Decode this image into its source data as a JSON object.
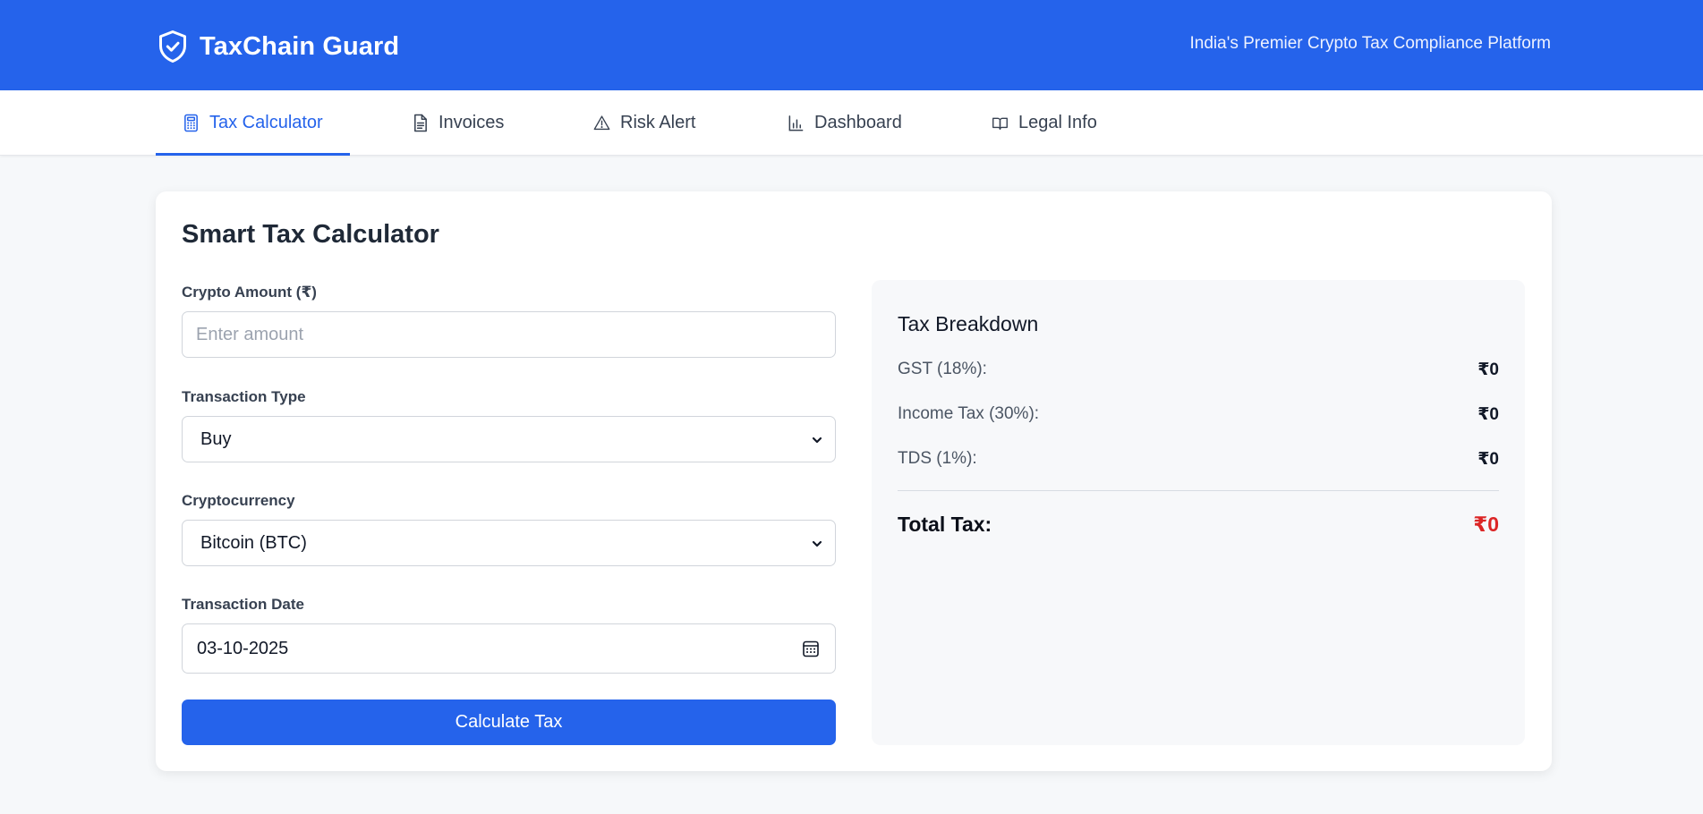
{
  "header": {
    "brand": "TaxChain Guard",
    "tagline": "India's Premier Crypto Tax Compliance Platform",
    "logo_icon": "shield-check-icon",
    "background_color": "#2563eb"
  },
  "nav": {
    "active_color": "#2563eb",
    "tabs": [
      {
        "label": "Tax Calculator",
        "icon": "calculator-icon",
        "active": true
      },
      {
        "label": "Invoices",
        "icon": "document-icon",
        "active": false
      },
      {
        "label": "Risk Alert",
        "icon": "warning-icon",
        "active": false
      },
      {
        "label": "Dashboard",
        "icon": "bar-chart-icon",
        "active": false
      },
      {
        "label": "Legal Info",
        "icon": "book-icon",
        "active": false
      }
    ]
  },
  "calculator": {
    "title": "Smart Tax Calculator",
    "amount": {
      "label": "Crypto Amount (₹)",
      "placeholder": "Enter amount",
      "value": ""
    },
    "transaction_type": {
      "label": "Transaction Type",
      "selected": "Buy"
    },
    "cryptocurrency": {
      "label": "Cryptocurrency",
      "selected": "Bitcoin (BTC)"
    },
    "date": {
      "label": "Transaction Date",
      "value": "03-10-2025"
    },
    "submit_label": "Calculate Tax"
  },
  "breakdown": {
    "title": "Tax Breakdown",
    "rows": [
      {
        "label": "GST (18%):",
        "value": "₹0"
      },
      {
        "label": "Income Tax (30%):",
        "value": "₹0"
      },
      {
        "label": "TDS (1%):",
        "value": "₹0"
      }
    ],
    "total": {
      "label": "Total Tax:",
      "value": "₹0",
      "color": "#dc2626"
    }
  }
}
